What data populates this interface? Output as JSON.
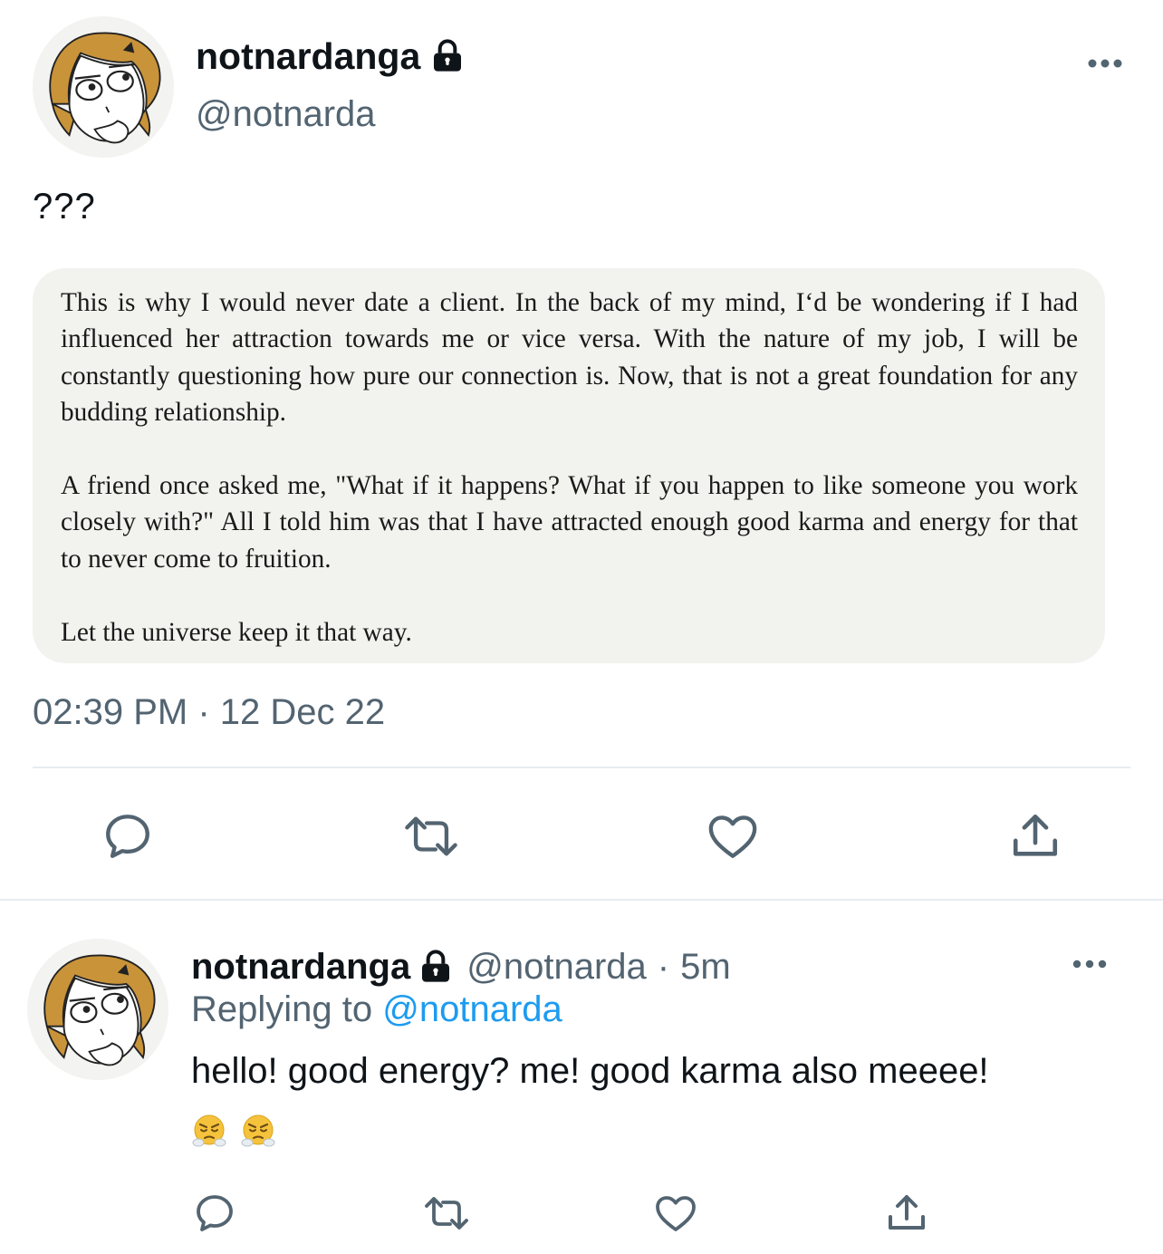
{
  "main_tweet": {
    "display_name": "notnardanga",
    "handle": "@notnarda",
    "text": "???",
    "quote_paragraphs": [
      "This is why I would never date a client. In the back of my mind, I‘d be wondering if I had influenced her attraction towards me or vice versa. With the nature of my job, I will be constantly questioning how pure our connection is. Now, that is not a great foundation for any budding relationship.",
      "A friend once asked me, \"What if it happens? What if you happen to like someone you work closely with?\" All I told him was that I have attracted enough good karma and energy for that to never come to fruition.",
      "Let the universe keep it that way."
    ],
    "timestamp": "02:39 PM · 12 Dec 22"
  },
  "reply": {
    "display_name": "notnardanga",
    "handle": "@notnarda",
    "separator": "·",
    "time_ago": "5m",
    "replying_label": "Replying to",
    "replying_to": "@notnarda",
    "text": "hello! good energy? me! good karma also meeee!"
  },
  "icons": {
    "lock": "lock-icon",
    "more": "more-horizontal-icon",
    "reply": "reply-bubble-icon",
    "retweet": "retweet-icon",
    "like": "heart-icon",
    "share": "share-upload-icon",
    "emoji": "face-with-steam-from-nose-emoji"
  },
  "colors": {
    "text": "#0f1419",
    "secondary": "#536471",
    "link": "#1d9bf0",
    "quote_bg": "#f2f2ef",
    "divider": "#e6ecf0",
    "avatar_hair": "#c9933a"
  }
}
